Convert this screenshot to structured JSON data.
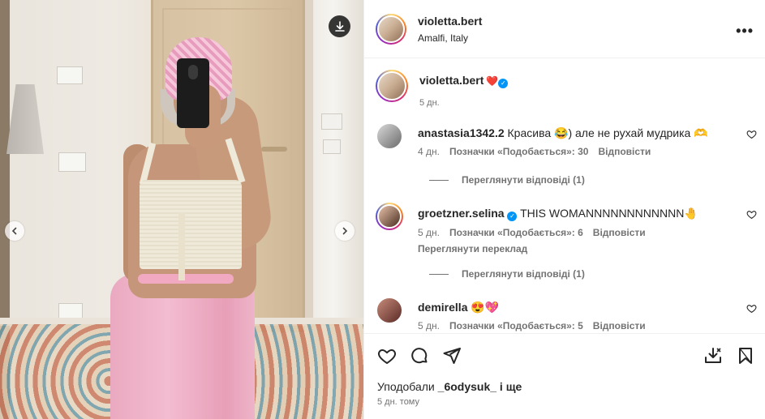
{
  "post": {
    "username": "violetta.bert",
    "location": "Amalfi, Italy",
    "more_icon": "more-horizontal-icon",
    "caption_emoji": "❤️",
    "caption_time": "5 дн."
  },
  "comments": [
    {
      "username": "anastasia1342.2",
      "text": "Красива 😂) але не рухай мудрика 🫶",
      "time": "4 дн.",
      "likes": "Позначки «Подобається»: 30",
      "reply": "Відповісти",
      "view_replies": "Переглянути відповіді (1)"
    },
    {
      "username": "groetzner.selina",
      "text": "THIS WOMANNNNNNNNNNNN🤚",
      "time": "5 дн.",
      "likes": "Позначки «Подобається»: 6",
      "reply": "Відповісти",
      "see_translation": "Переглянути переклад",
      "view_replies": "Переглянути відповіді (1)"
    },
    {
      "username": "demirella",
      "text": "😍💖",
      "time": "5 дн.",
      "likes": "Позначки «Подобається»: 5",
      "reply": "Відповісти"
    }
  ],
  "footer": {
    "liked_prefix": "Уподобали ",
    "liked_user": "_6odysuk_",
    "liked_suffix": " і ще",
    "time": "5 дн. тому"
  },
  "colors": {
    "verified": "#0095f6",
    "text": "#262626",
    "muted": "#737373"
  }
}
